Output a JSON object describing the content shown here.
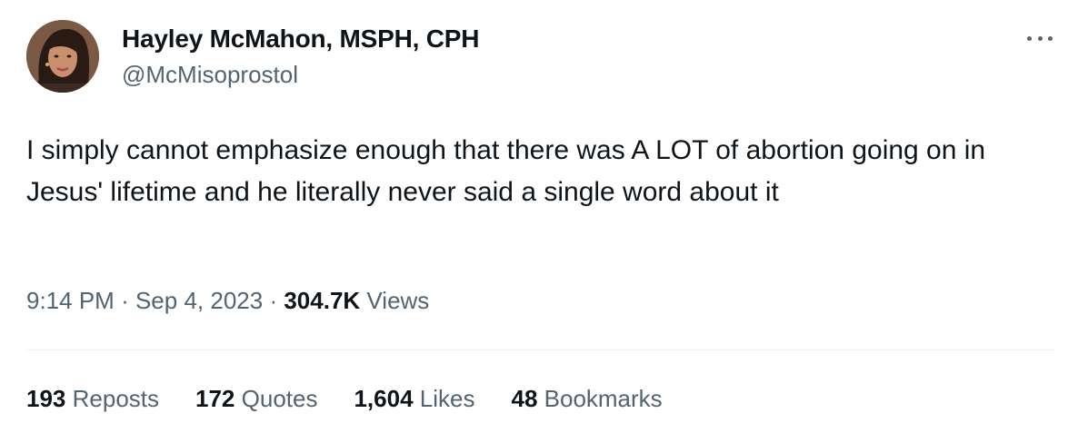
{
  "author": {
    "display_name": "Hayley McMahon, MSPH, CPH",
    "handle": "@McMisoprostol"
  },
  "tweet": {
    "text": "I simply cannot emphasize enough that there was A LOT of abortion going on in Jesus' lifetime and he literally never said a single word about it",
    "time": "9:14 PM",
    "separator": "·",
    "date": "Sep 4, 2023",
    "views_count": "304.7K",
    "views_label": "Views"
  },
  "stats": [
    {
      "count": "193",
      "label": "Reposts"
    },
    {
      "count": "172",
      "label": "Quotes"
    },
    {
      "count": "1,604",
      "label": "Likes"
    },
    {
      "count": "48",
      "label": "Bookmarks"
    }
  ],
  "icons": {
    "more": "more-horizontal-icon",
    "avatar": "profile-photo"
  },
  "colors": {
    "text_primary": "#0f1419",
    "text_secondary": "#536471",
    "divider": "#eff3f4"
  }
}
